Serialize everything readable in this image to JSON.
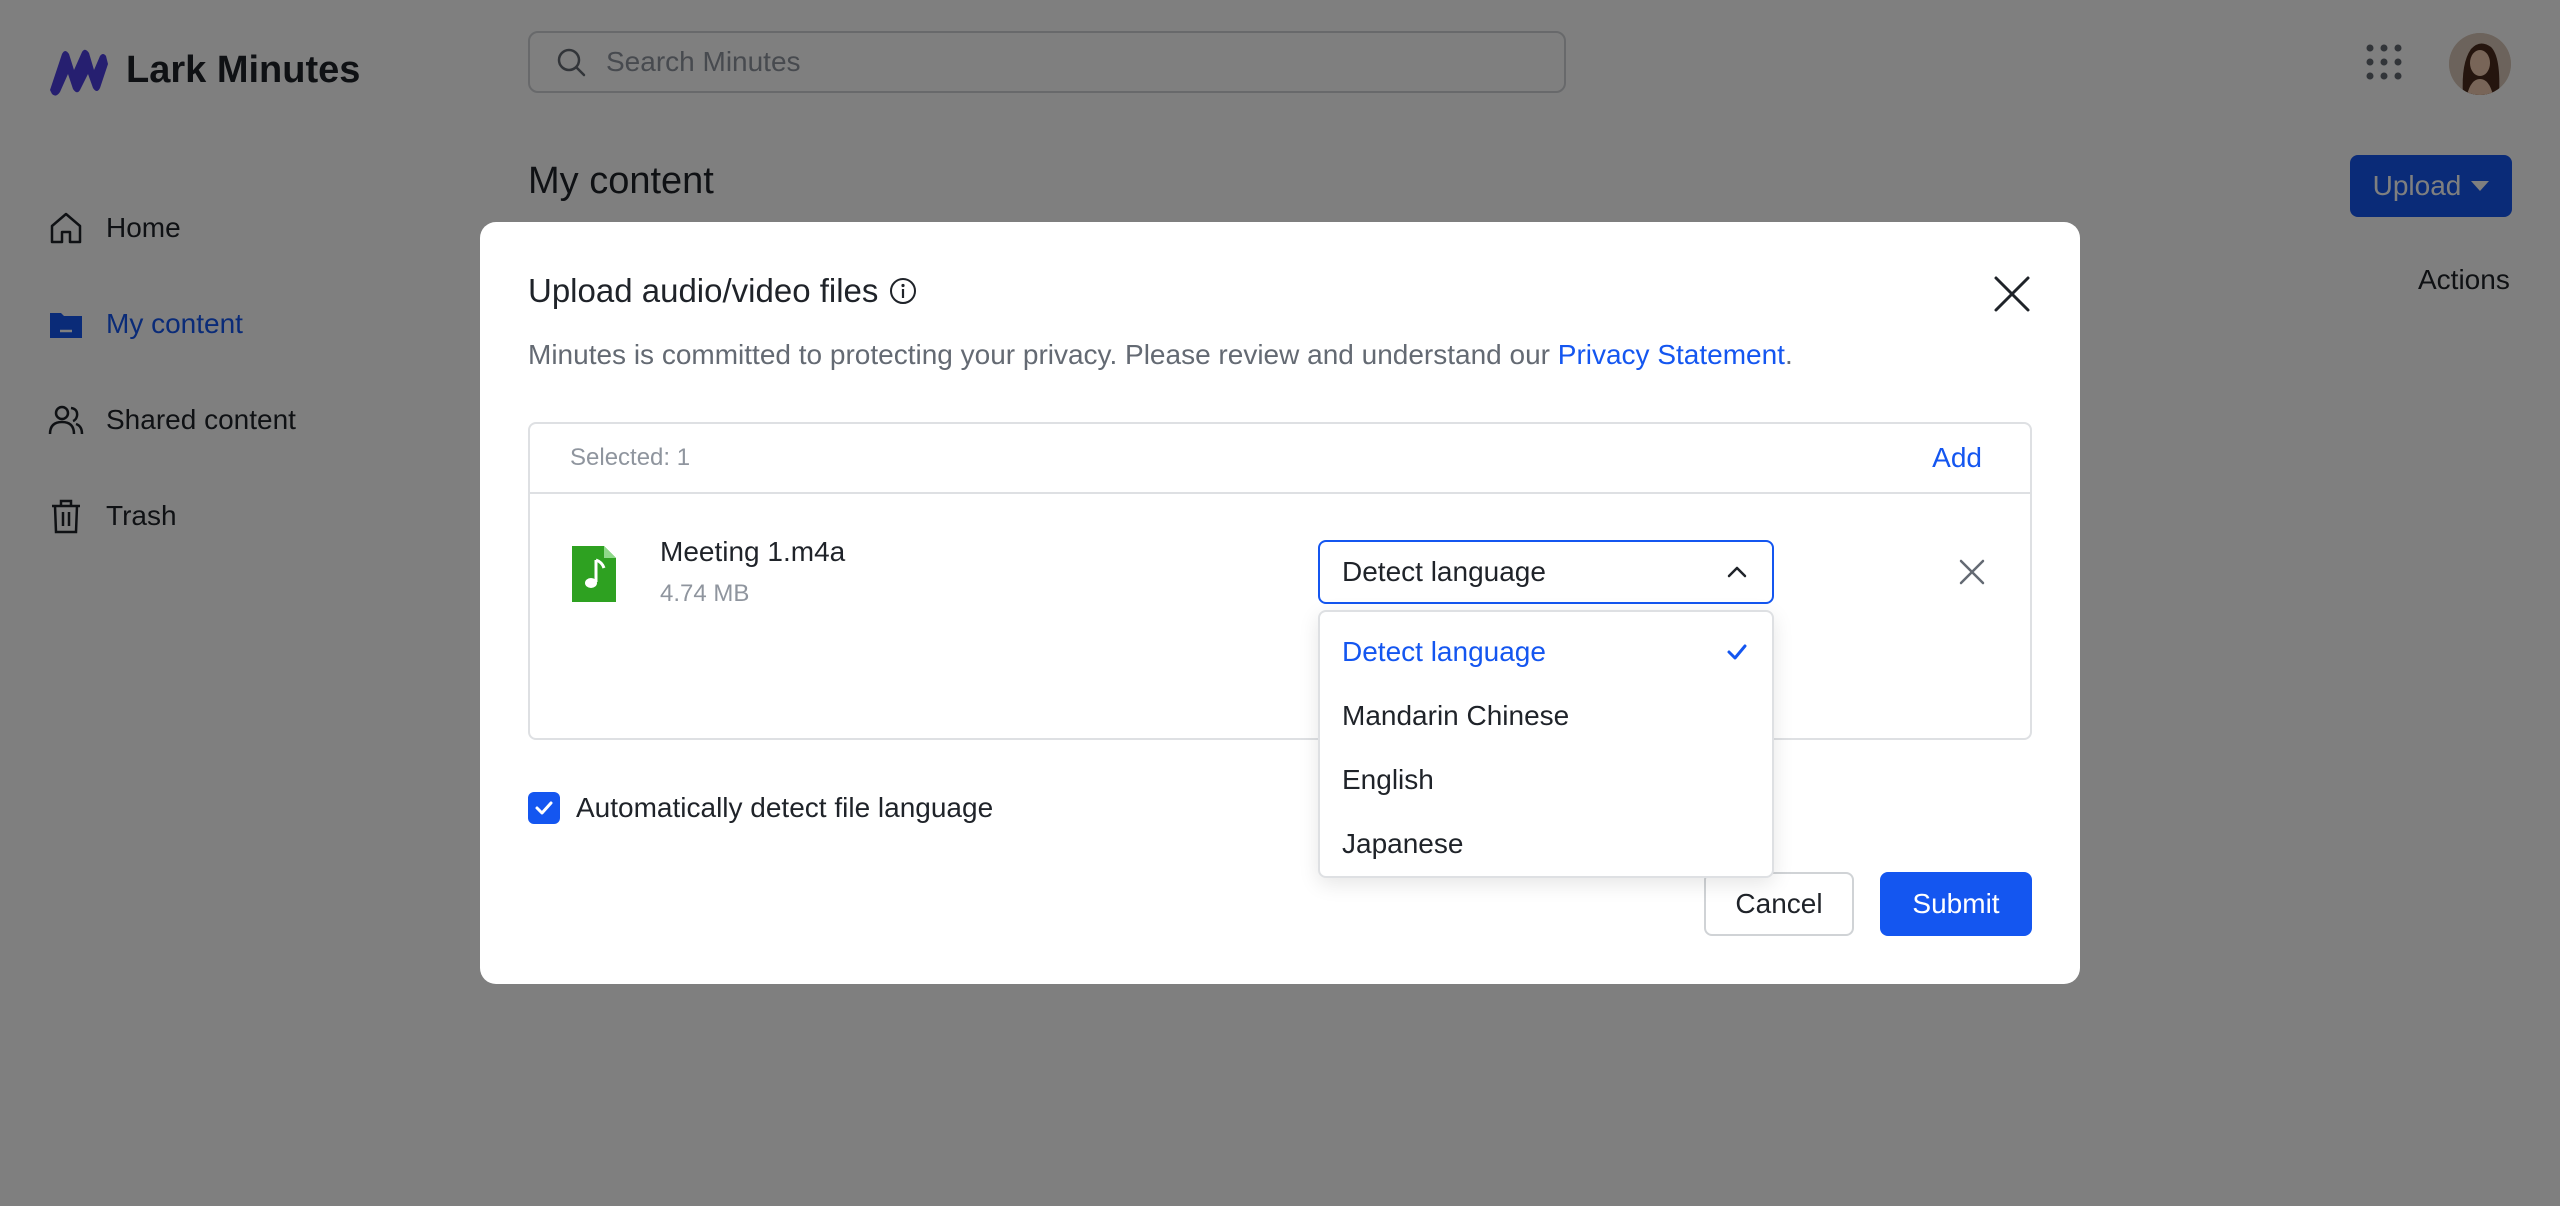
{
  "app": {
    "name": "Lark Minutes",
    "search_placeholder": "Search Minutes",
    "nav": [
      {
        "label": "Home",
        "icon": "home-icon"
      },
      {
        "label": "My content",
        "icon": "folder-icon",
        "active": true
      },
      {
        "label": "Shared content",
        "icon": "users-icon"
      },
      {
        "label": "Trash",
        "icon": "trash-icon"
      }
    ],
    "page_title": "My content",
    "upload_label": "Upload",
    "actions_label": "Actions"
  },
  "modal": {
    "title": "Upload audio/video files",
    "privacy_text": "Minutes is committed to protecting your privacy. Please review and understand our ",
    "privacy_link": "Privacy Statement",
    "privacy_end": ".",
    "selected_count": "Selected: 1",
    "add_label": "Add",
    "file": {
      "name": "Meeting 1.m4a",
      "size": "4.74 MB"
    },
    "language_value": "Detect language",
    "auto_detect_label": "Automatically detect file language",
    "cancel_label": "Cancel",
    "submit_label": "Submit"
  },
  "dropdown": {
    "options": [
      "Detect language",
      "Mandarin Chinese",
      "English",
      "Japanese"
    ],
    "selected": "Detect language"
  },
  "colors": {
    "accent": "#1456f0",
    "file_icon": "#2ea121"
  }
}
